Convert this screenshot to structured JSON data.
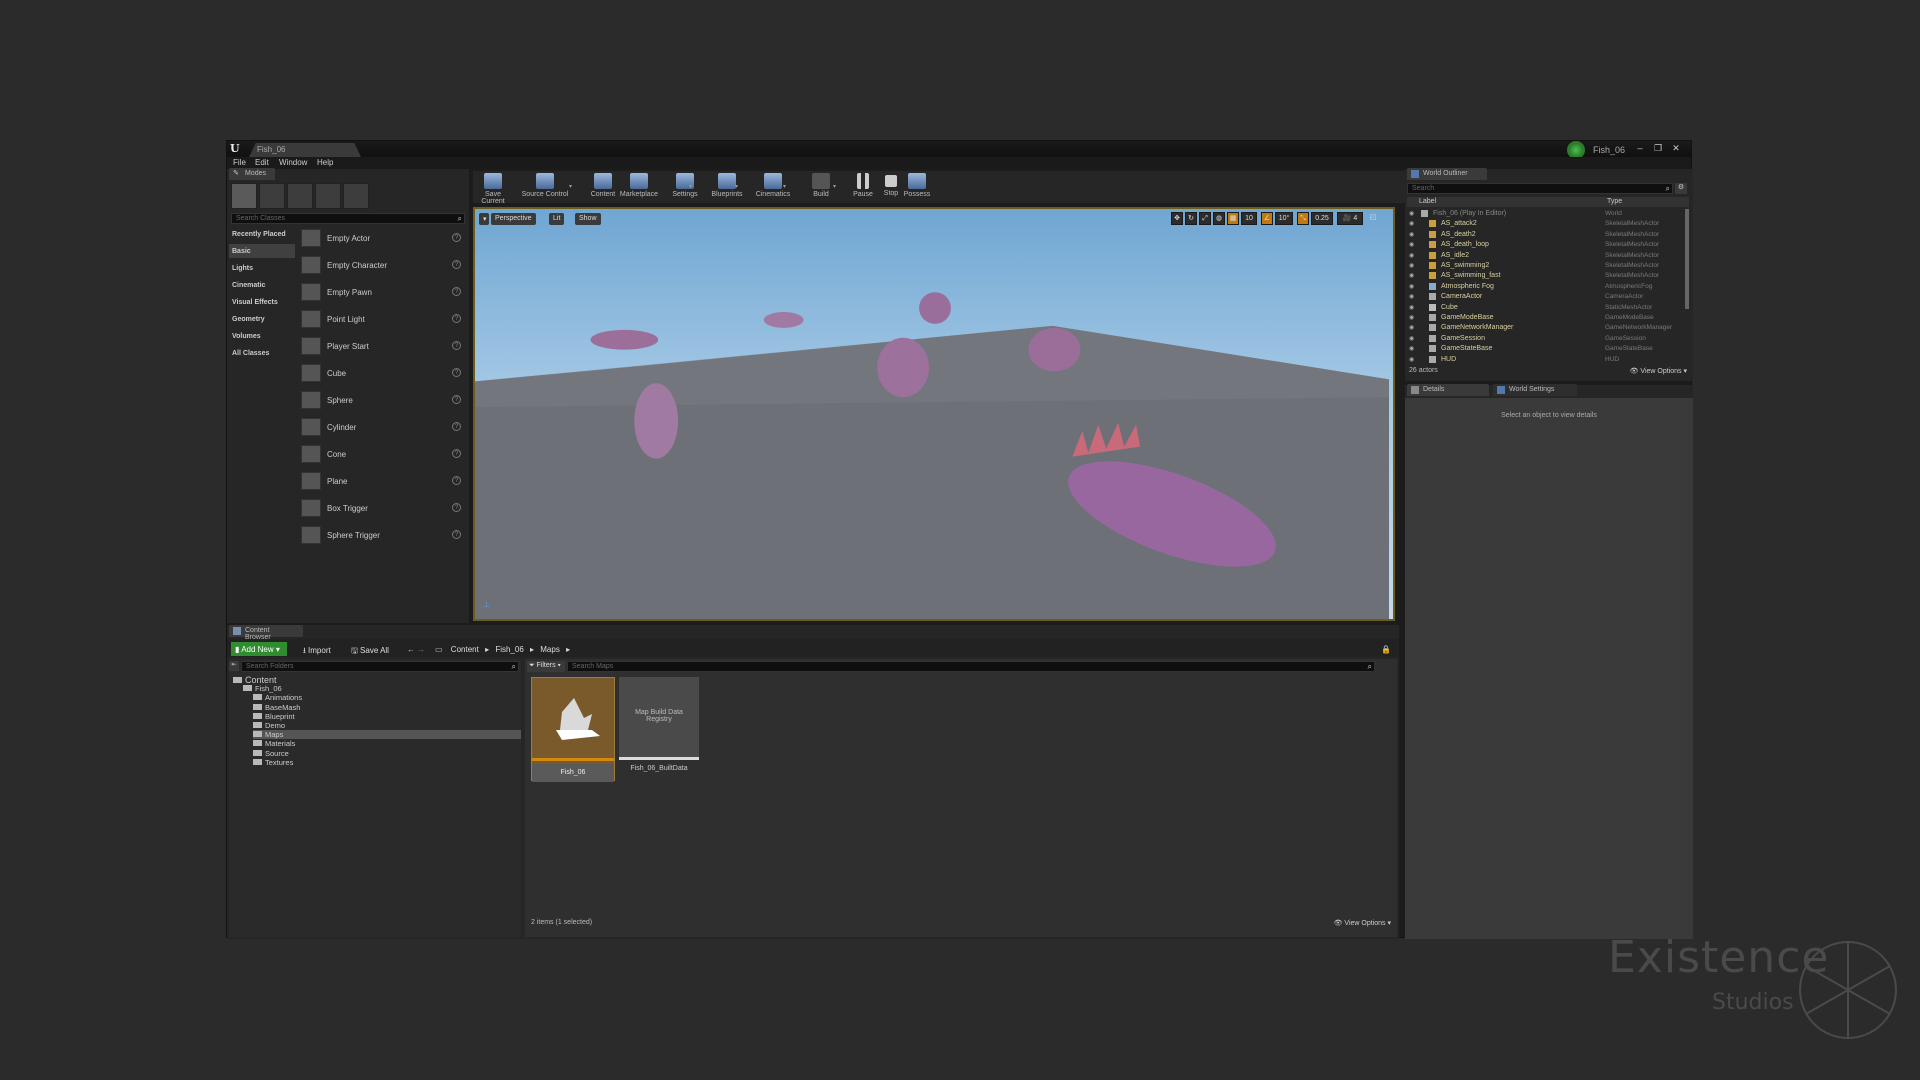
{
  "window": {
    "doc_tab": "Fish_06",
    "project_name": "Fish_06",
    "controls": [
      "–",
      "❐",
      "✕"
    ]
  },
  "menu": [
    "File",
    "Edit",
    "Window",
    "Help"
  ],
  "modes": {
    "tab": "Modes",
    "search_placeholder": "Search Classes",
    "categories": [
      "Recently Placed",
      "Basic",
      "Lights",
      "Cinematic",
      "Visual Effects",
      "Geometry",
      "Volumes",
      "All Classes"
    ],
    "selected_category": "Basic",
    "actors": [
      "Empty Actor",
      "Empty Character",
      "Empty Pawn",
      "Point Light",
      "Player Start",
      "Cube",
      "Sphere",
      "Cylinder",
      "Cone",
      "Plane",
      "Box Trigger",
      "Sphere Trigger"
    ]
  },
  "toolbar": {
    "buttons": [
      "Save Current",
      "Source Control",
      "Content",
      "Marketplace",
      "Settings",
      "Blueprints",
      "Cinematics",
      "Build",
      "Pause",
      "Stop",
      "Possess"
    ]
  },
  "viewport": {
    "perspective": "Perspective",
    "lit": "Lit",
    "show": "Show",
    "grid_snap": "10",
    "rot_snap": "10°",
    "scale_snap": "0.25",
    "camera_speed": "4"
  },
  "outliner": {
    "tab": "World Outliner",
    "search_placeholder": "Search",
    "col_label": "Label",
    "col_type": "Type",
    "rows": [
      {
        "label": "Fish_06 (Play In Editor)",
        "type": "World"
      },
      {
        "label": "AS_attack2",
        "type": "SkeletalMeshActor"
      },
      {
        "label": "AS_death2",
        "type": "SkeletalMeshActor"
      },
      {
        "label": "AS_death_loop",
        "type": "SkeletalMeshActor"
      },
      {
        "label": "AS_idle2",
        "type": "SkeletalMeshActor"
      },
      {
        "label": "AS_swimming2",
        "type": "SkeletalMeshActor"
      },
      {
        "label": "AS_swimming_fast",
        "type": "SkeletalMeshActor"
      },
      {
        "label": "Atmospheric Fog",
        "type": "AtmosphericFog"
      },
      {
        "label": "CameraActor",
        "type": "CameraActor"
      },
      {
        "label": "Cube",
        "type": "StaticMeshActor"
      },
      {
        "label": "GameModeBase",
        "type": "GameModeBase"
      },
      {
        "label": "GameNetworkManager",
        "type": "GameNetworkManager"
      },
      {
        "label": "GameSession",
        "type": "GameSession"
      },
      {
        "label": "GameStateBase",
        "type": "GameStateBase"
      },
      {
        "label": "HUD",
        "type": "HUD"
      }
    ],
    "count": "26 actors",
    "view_options": "View Options"
  },
  "details": {
    "tab_details": "Details",
    "tab_world": "World Settings",
    "empty_msg": "Select an object to view details"
  },
  "content_browser": {
    "tab": "Content Browser",
    "add_new": "Add New",
    "import": "Import",
    "save_all": "Save All",
    "path": [
      "Content",
      "Fish_06",
      "Maps"
    ],
    "search_folders": "Search Folders",
    "filters": "Filters",
    "search_assets": "Search Maps",
    "tree": [
      {
        "name": "Content",
        "depth": 0
      },
      {
        "name": "Fish_06",
        "depth": 1
      },
      {
        "name": "Animations",
        "depth": 2
      },
      {
        "name": "BaseMash",
        "depth": 2
      },
      {
        "name": "Blueprint",
        "depth": 2
      },
      {
        "name": "Demo",
        "depth": 2
      },
      {
        "name": "Maps",
        "depth": 2
      },
      {
        "name": "Materials",
        "depth": 2
      },
      {
        "name": "Source",
        "depth": 2
      },
      {
        "name": "Textures",
        "depth": 2
      }
    ],
    "selected_folder": "Maps",
    "assets": [
      {
        "name": "Fish_06",
        "thumb_text": ""
      },
      {
        "name": "Fish_06_BuiltData",
        "thumb_text": "Map Build Data Registry"
      }
    ],
    "status": "2 items (1 selected)",
    "view_options": "View Options"
  },
  "watermark": {
    "line1": "Existence",
    "line2": "Studios"
  },
  "colors": {
    "accent_green": "#2f8c2f",
    "viewport_border": "#6e5d1a",
    "selected_asset": "#7a5a2a"
  }
}
